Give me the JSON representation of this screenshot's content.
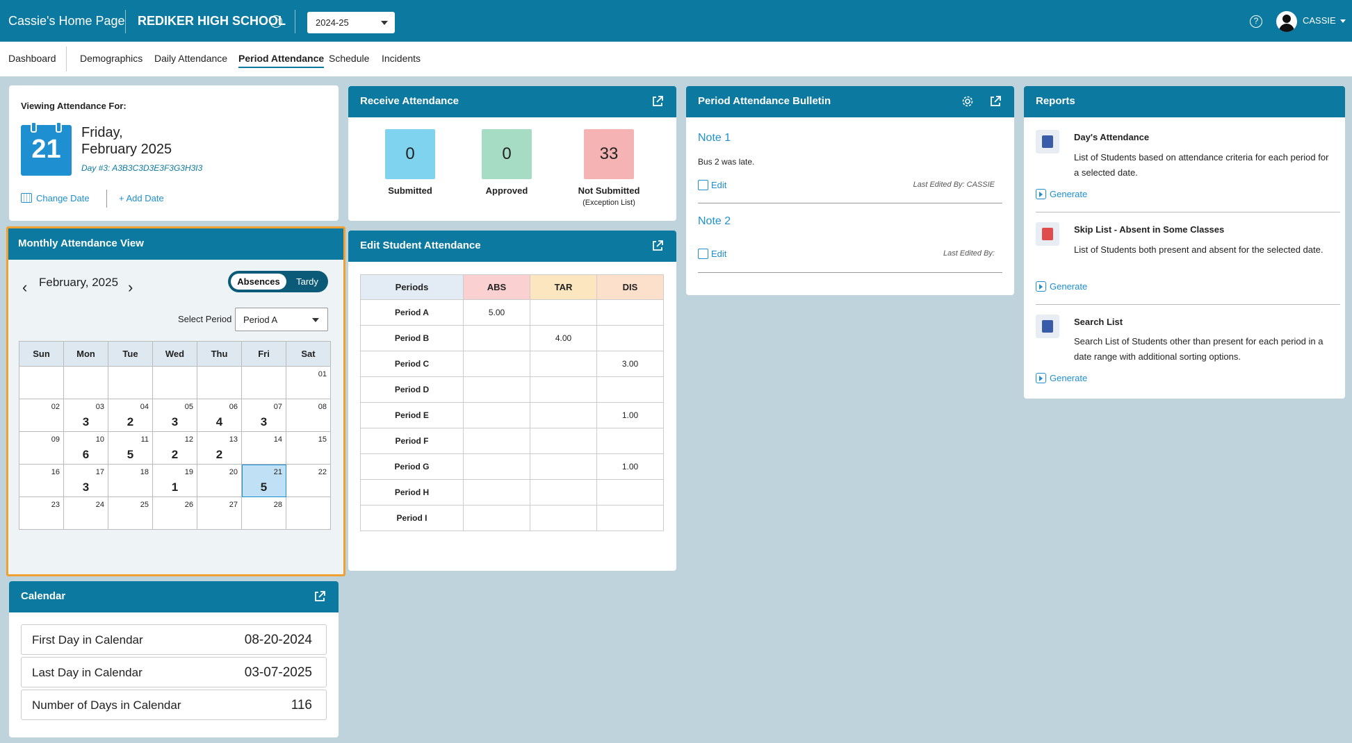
{
  "topbar": {
    "home_title": "Cassie's Home Page",
    "school_name": "REDIKER HIGH SCHOOL",
    "school_year": "2024-25",
    "user_name": "CASSIE",
    "help_glyph": "?"
  },
  "nav": {
    "tabs": [
      "Dashboard",
      "Demographics",
      "Daily Attendance",
      "Period Attendance",
      "Schedule",
      "Incidents"
    ],
    "active": "Period Attendance"
  },
  "viewing": {
    "label": "Viewing Attendance For:",
    "day_number": "21",
    "day_name": "Friday,",
    "date": "February 2025",
    "day_code": "Day #3: A3B3C3D3E3F3G3H3I3",
    "change_date": "Change Date",
    "add_date": "+ Add Date"
  },
  "monthly": {
    "title": "Monthly Attendance View",
    "month": "February, 2025",
    "toggle_on": "Absences",
    "toggle_off": "Tardy",
    "select_label": "Select Period",
    "select_value": "Period A",
    "weekdays": [
      "Sun",
      "Mon",
      "Tue",
      "Wed",
      "Thu",
      "Fri",
      "Sat"
    ],
    "weeks": [
      [
        {
          "d": ""
        },
        {
          "d": ""
        },
        {
          "d": ""
        },
        {
          "d": ""
        },
        {
          "d": ""
        },
        {
          "d": ""
        },
        {
          "d": "01"
        }
      ],
      [
        {
          "d": "02"
        },
        {
          "d": "03",
          "c": "3"
        },
        {
          "d": "04",
          "c": "2"
        },
        {
          "d": "05",
          "c": "3"
        },
        {
          "d": "06",
          "c": "4"
        },
        {
          "d": "07",
          "c": "3"
        },
        {
          "d": "08"
        }
      ],
      [
        {
          "d": "09"
        },
        {
          "d": "10",
          "c": "6"
        },
        {
          "d": "11",
          "c": "5"
        },
        {
          "d": "12",
          "c": "2"
        },
        {
          "d": "13",
          "c": "2"
        },
        {
          "d": "14"
        },
        {
          "d": "15"
        }
      ],
      [
        {
          "d": "16"
        },
        {
          "d": "17",
          "c": "3"
        },
        {
          "d": "18"
        },
        {
          "d": "19",
          "c": "1"
        },
        {
          "d": "20"
        },
        {
          "d": "21",
          "c": "5",
          "today": true
        },
        {
          "d": "22"
        }
      ],
      [
        {
          "d": "23"
        },
        {
          "d": "24"
        },
        {
          "d": "25"
        },
        {
          "d": "26"
        },
        {
          "d": "27"
        },
        {
          "d": "28"
        },
        {
          "d": ""
        }
      ]
    ]
  },
  "calendar": {
    "title": "Calendar",
    "rows": [
      {
        "label": "First Day in Calendar",
        "value": "08-20-2024"
      },
      {
        "label": "Last Day in Calendar",
        "value": "03-07-2025"
      },
      {
        "label": "Number of Days in Calendar",
        "value": "116"
      }
    ]
  },
  "receive": {
    "title": "Receive Attendance",
    "submitted": {
      "value": "0",
      "label": "Submitted",
      "color": "#7fd3ef"
    },
    "approved": {
      "value": "0",
      "label": "Approved",
      "color": "#a6dcc4"
    },
    "not_submitted": {
      "value": "33",
      "label": "Not Submitted",
      "sub": "(Exception List)",
      "color": "#f5b3b3"
    }
  },
  "edit_student": {
    "title": "Edit Student Attendance",
    "columns": [
      "Periods",
      "ABS",
      "TAR",
      "DIS"
    ],
    "column_colors": [
      "#e3ecf5",
      "#fbd0d0",
      "#fbe6c0",
      "#fde0cc"
    ],
    "rows": [
      [
        "Period A",
        "5.00",
        "",
        ""
      ],
      [
        "Period B",
        "",
        "4.00",
        ""
      ],
      [
        "Period C",
        "",
        "",
        "3.00"
      ],
      [
        "Period D",
        "",
        "",
        ""
      ],
      [
        "Period E",
        "",
        "",
        "1.00"
      ],
      [
        "Period F",
        "",
        "",
        ""
      ],
      [
        "Period G",
        "",
        "",
        "1.00"
      ],
      [
        "Period H",
        "",
        "",
        ""
      ],
      [
        "Period I",
        "",
        "",
        ""
      ]
    ]
  },
  "bulletin": {
    "title": "Period Attendance Bulletin",
    "notes": [
      {
        "title": "Note 1",
        "body": "Bus 2 was late.",
        "edit": "Edit",
        "meta": "Last Edited By: CASSIE"
      },
      {
        "title": "Note 2",
        "body": "",
        "edit": "Edit",
        "meta": "Last Edited By:"
      }
    ]
  },
  "reports": {
    "title": "Reports",
    "items": [
      {
        "title": "Day's Attendance",
        "desc": "List of Students based on attendance criteria for each period for a selected date.",
        "action": "Generate",
        "icon_color": "#3a5ba8"
      },
      {
        "title": "Skip List - Absent in Some Classes",
        "desc": "List of Students both present and absent for the selected date.",
        "action": "Generate",
        "icon_color": "#e04b4b"
      },
      {
        "title": "Search List",
        "desc": "Search List of Students other than present for each period in a date range with additional sorting options.",
        "action": "Generate",
        "icon_color": "#3a5ba8"
      }
    ]
  }
}
